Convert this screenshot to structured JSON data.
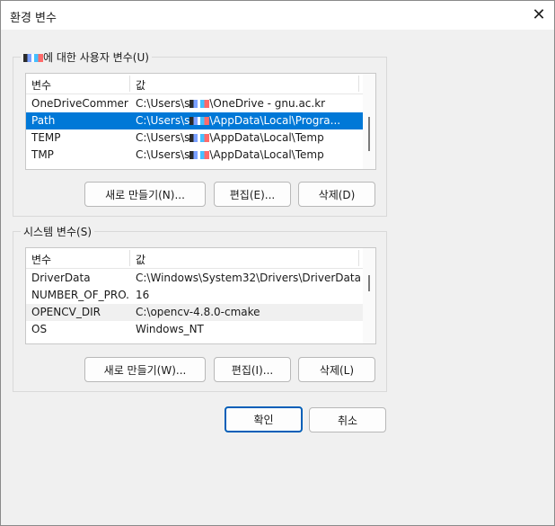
{
  "window": {
    "title": "환경 변수"
  },
  "user_group": {
    "label_suffix": "에 대한 사용자 변수(U)",
    "col_name": "변수",
    "col_value": "값",
    "rows": [
      {
        "name": "OneDriveCommer...",
        "value_pre": "C:\\Users\\s",
        "value_post": "\\OneDrive - gnu.ac.kr"
      },
      {
        "name": "Path",
        "value_pre": "C:\\Users\\s",
        "value_post": "\\AppData\\Local\\Progra..."
      },
      {
        "name": "TEMP",
        "value_pre": "C:\\Users\\s",
        "value_post": "\\AppData\\Local\\Temp"
      },
      {
        "name": "TMP",
        "value_pre": "C:\\Users\\s",
        "value_post": "\\AppData\\Local\\Temp"
      }
    ],
    "btn_new": "새로 만들기(N)...",
    "btn_edit": "편집(E)...",
    "btn_delete": "삭제(D)"
  },
  "system_group": {
    "label": "시스템 변수(S)",
    "col_name": "변수",
    "col_value": "값",
    "rows": [
      {
        "name": "DriverData",
        "value": "C:\\Windows\\System32\\Drivers\\DriverData"
      },
      {
        "name": "NUMBER_OF_PRO...",
        "value": "16"
      },
      {
        "name": "OPENCV_DIR",
        "value": "C:\\opencv-4.8.0-cmake"
      },
      {
        "name": "OS",
        "value": "Windows_NT"
      }
    ],
    "btn_new": "새로 만들기(W)...",
    "btn_edit": "편집(I)...",
    "btn_delete": "삭제(L)"
  },
  "footer": {
    "ok": "확인",
    "cancel": "취소"
  },
  "colors": {
    "selection": "#0078d7",
    "primary_border": "#005fb8"
  }
}
